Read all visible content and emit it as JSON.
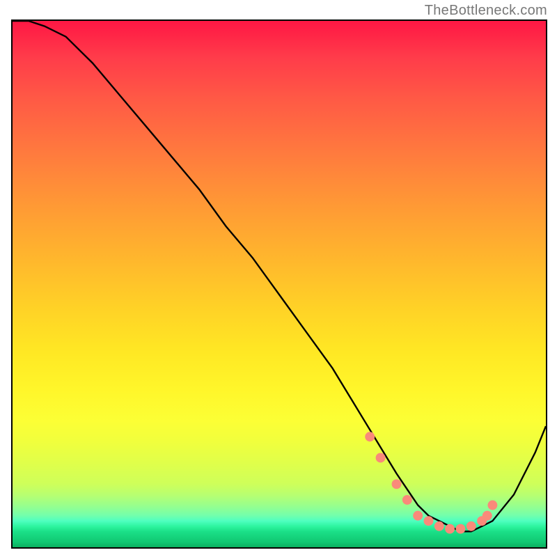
{
  "watermark": "TheBottleneck.com",
  "chart_data": {
    "type": "line",
    "title": "",
    "xlabel": "",
    "ylabel": "",
    "xlim": [
      0,
      100
    ],
    "ylim": [
      0,
      100
    ],
    "grid": false,
    "series": [
      {
        "name": "curve",
        "x": [
          0,
          3,
          6,
          10,
          15,
          20,
          25,
          30,
          35,
          40,
          45,
          50,
          55,
          60,
          63,
          66,
          69,
          72,
          74,
          76,
          78,
          80,
          82,
          84,
          86,
          88,
          90,
          94,
          98,
          100
        ],
        "values": [
          100,
          100,
          99,
          97,
          92,
          86,
          80,
          74,
          68,
          61,
          55,
          48,
          41,
          34,
          29,
          24,
          19,
          14,
          11,
          8,
          6,
          5,
          4,
          3,
          3,
          4,
          5,
          10,
          18,
          23
        ]
      }
    ],
    "markers": [
      {
        "x": 67,
        "y": 21
      },
      {
        "x": 69,
        "y": 17
      },
      {
        "x": 72,
        "y": 12
      },
      {
        "x": 74,
        "y": 9
      },
      {
        "x": 76,
        "y": 6
      },
      {
        "x": 78,
        "y": 5
      },
      {
        "x": 80,
        "y": 4
      },
      {
        "x": 82,
        "y": 3.5
      },
      {
        "x": 84,
        "y": 3.5
      },
      {
        "x": 86,
        "y": 4
      },
      {
        "x": 88,
        "y": 5
      },
      {
        "x": 89,
        "y": 6
      },
      {
        "x": 90,
        "y": 8
      }
    ],
    "marker_color": "#f98a7a",
    "line_color": "#000000"
  }
}
